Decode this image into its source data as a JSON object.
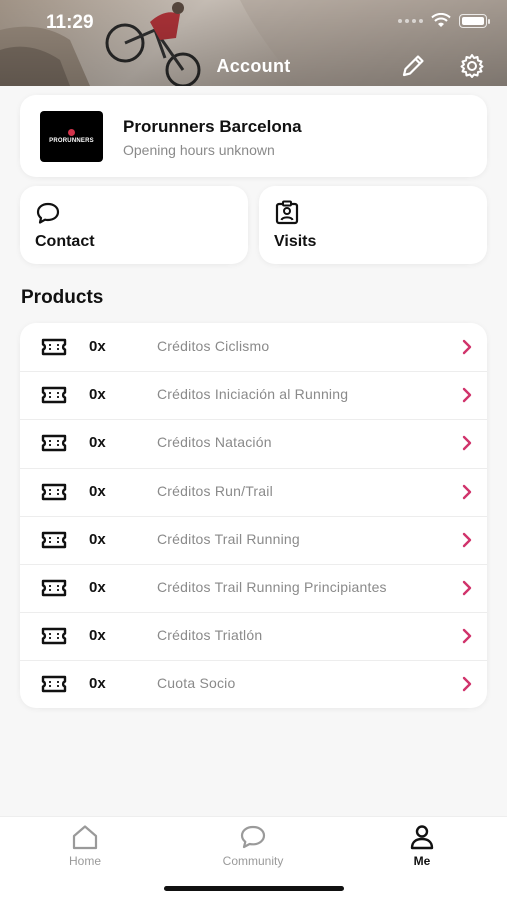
{
  "status_bar": {
    "time": "11:29"
  },
  "header": {
    "title": "Account",
    "edit_icon": "pencil-icon",
    "settings_icon": "gear-icon"
  },
  "store": {
    "name": "Prorunners Barcelona",
    "hours": "Opening hours unknown",
    "logo_text": "PRORUNNERS"
  },
  "tiles": {
    "contact": {
      "label": "Contact",
      "icon": "chat-bubble-icon"
    },
    "visits": {
      "label": "Visits",
      "icon": "badge-icon"
    }
  },
  "products": {
    "title": "Products",
    "items": [
      {
        "qty": "0x",
        "name": "Créditos Ciclismo"
      },
      {
        "qty": "0x",
        "name": "Créditos Iniciación al Running"
      },
      {
        "qty": "0x",
        "name": "Créditos Natación"
      },
      {
        "qty": "0x",
        "name": "Créditos Run/Trail"
      },
      {
        "qty": "0x",
        "name": "Créditos Trail Running"
      },
      {
        "qty": "0x",
        "name": "Créditos Trail Running Principiantes"
      },
      {
        "qty": "0x",
        "name": "Créditos Triatlón"
      },
      {
        "qty": "0x",
        "name": "Cuota Socio"
      }
    ]
  },
  "tabbar": {
    "home": "Home",
    "community": "Community",
    "me": "Me"
  },
  "colors": {
    "accent": "#d0336b",
    "muted_text": "#8a8a8a",
    "background": "#f7f7f7"
  }
}
